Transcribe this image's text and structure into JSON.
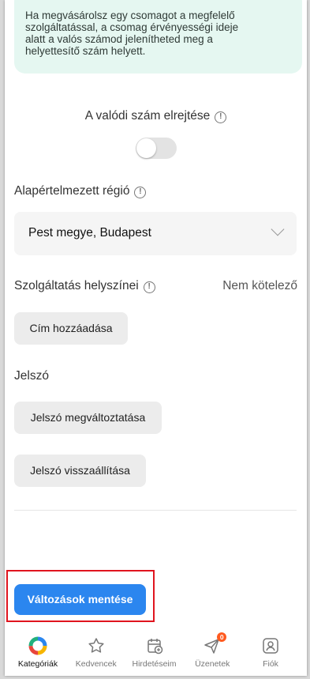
{
  "info_box": {
    "lines": [
      "Ha megvásárolsz egy csomagot a megfelelő",
      "szolgáltatással, a csomag érvényességi ideje",
      "alatt a valós számod jelenítheted meg a",
      "helyettesítő szám helyett."
    ]
  },
  "hide_number": {
    "label": "A valódi szám elrejtése",
    "enabled": false
  },
  "region": {
    "label": "Alapértelmezett régió",
    "value": "Pest megye, Budapest"
  },
  "service": {
    "label": "Szolgáltatás helyszínei",
    "optional": "Nem kötelező",
    "add_button": "Cím hozzáadása"
  },
  "password": {
    "label": "Jelszó",
    "change_button": "Jelszó megváltoztatása",
    "reset_button": "Jelszó visszaállítása"
  },
  "save_button": "Változások mentése",
  "tabs": [
    {
      "label": "Kategóriák",
      "icon": "categories-icon",
      "active": true
    },
    {
      "label": "Kedvencek",
      "icon": "star-icon"
    },
    {
      "label": "Hirdetéseim",
      "icon": "calendar-add-icon"
    },
    {
      "label": "Üzenetek",
      "icon": "paper-plane-icon",
      "badge": "0"
    },
    {
      "label": "Fiók",
      "icon": "account-icon"
    }
  ],
  "colors": {
    "accent": "#2b86ef",
    "info_bg": "#e5f7f1",
    "highlight": "#e0141e",
    "badge": "#ff5a1f"
  }
}
